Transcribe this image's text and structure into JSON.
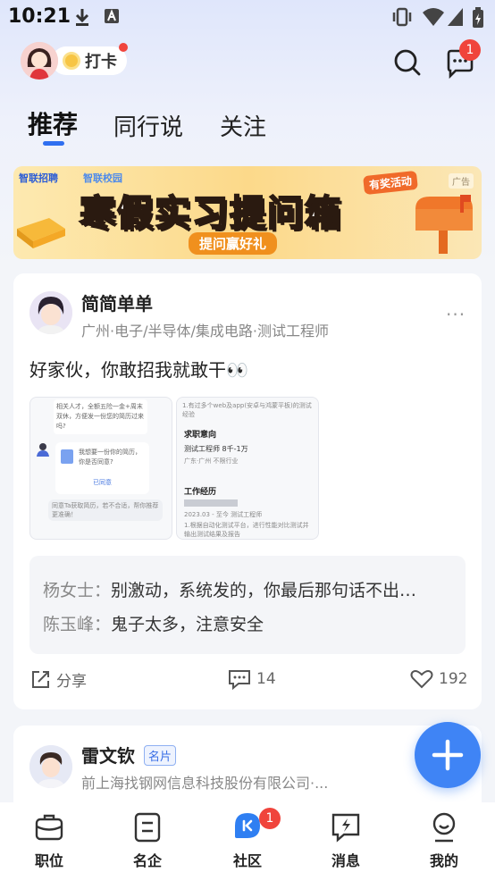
{
  "status_bar": {
    "time": "10:21"
  },
  "header": {
    "checkin_label": "打卡",
    "message_badge": "1"
  },
  "tabs": [
    {
      "label": "推荐",
      "active": true
    },
    {
      "label": "同行说",
      "active": false
    },
    {
      "label": "关注",
      "active": false
    }
  ],
  "banner": {
    "brand": "智联招聘",
    "brand2": "智联校园",
    "title": "寒假实习提问箱",
    "tag": "有奖活动",
    "subtitle": "提问赢好礼",
    "ad_label": "广告"
  },
  "post1": {
    "user_name": "简简单单",
    "user_meta": "广州·电子/半导体/集成电路·测试工程师",
    "text": "好家伙，你敢招我就敢干👀",
    "thumb1": {
      "msg1": "相关人才，全额五险一金+周末双休，方便发一份您的简历过来吗?",
      "msg2": "我想要一份你的简历，你是否同意?",
      "status": "已同意",
      "notice": "同意Ta获取简历，若不合适，帮你推荐更准确！"
    },
    "thumb2": {
      "line1": "1.有过多个web及app(安卓与鸿蒙平板)的测试经验",
      "section1": "求职意向",
      "job": "测试工程师  8千-1万",
      "location": "广东·广州  不限行业",
      "section2": "工作经历",
      "period": "2023.03 - 至今  测试工程师",
      "detail": "1.根据自动化测试平台，进行性能对比测试并输出测试结果及报告"
    },
    "comments": [
      {
        "who": "杨女士：",
        "text": "别激动，系统发的，你最后那句话不出…"
      },
      {
        "who": "陈玉峰：",
        "text": "鬼子太多，注意安全"
      }
    ],
    "share_label": "分享",
    "comment_count": "14",
    "like_count": "192"
  },
  "post2": {
    "user_name": "雷文钦",
    "tag": "名片",
    "user_meta": "前上海找钢网信息科技股份有限公司·..."
  },
  "bottom_nav": {
    "items": [
      {
        "label": "职位"
      },
      {
        "label": "名企"
      },
      {
        "label": "社区"
      },
      {
        "label": "消息"
      },
      {
        "label": "我的"
      }
    ],
    "community_badge": "1"
  }
}
